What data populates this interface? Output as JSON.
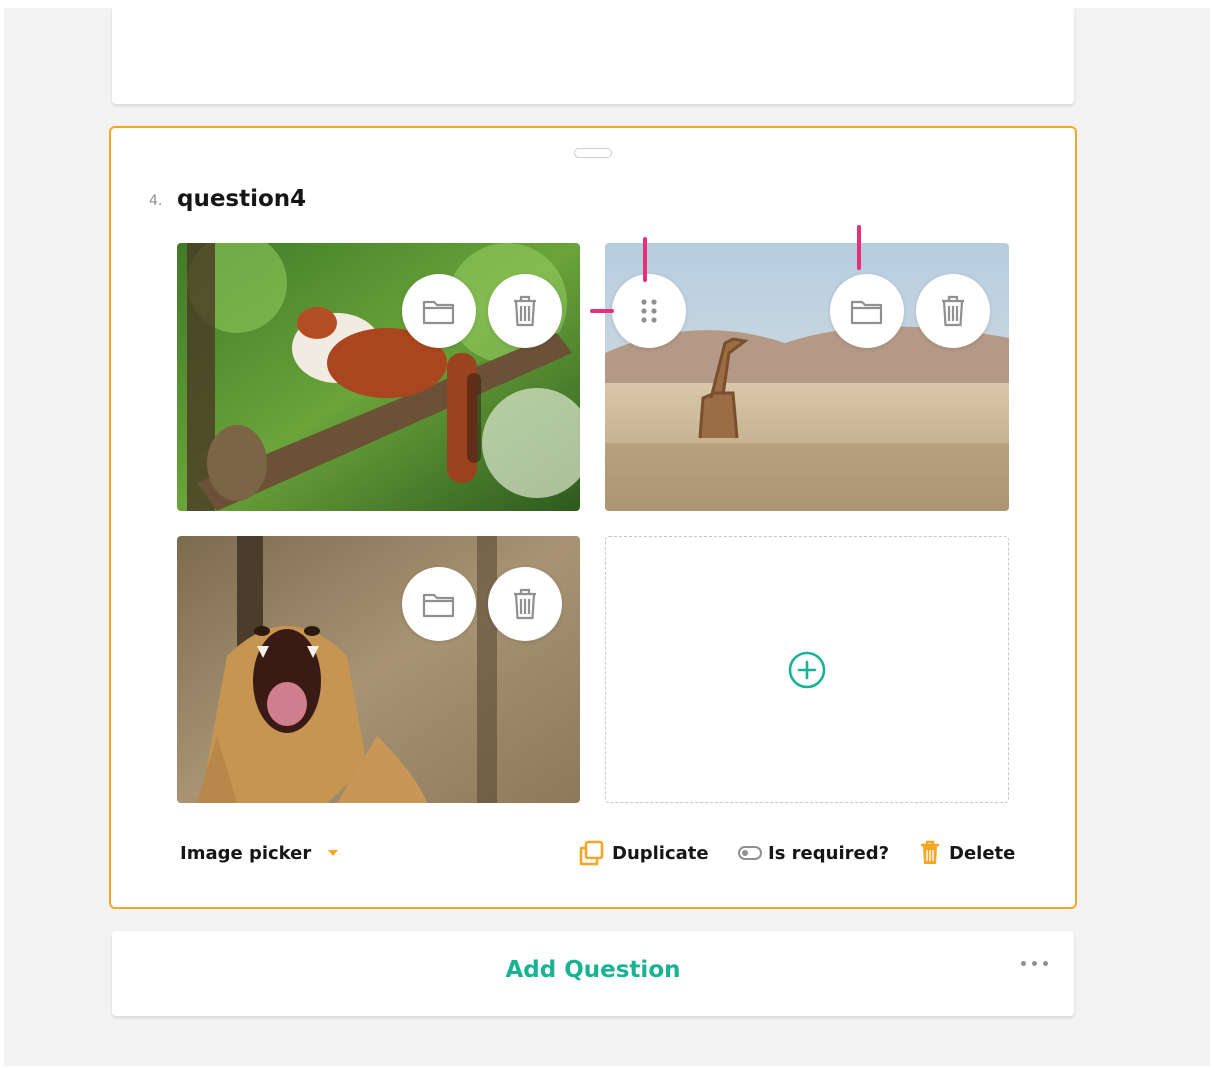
{
  "question": {
    "number": "4.",
    "title": "question4"
  },
  "footer": {
    "type_label": "Image picker",
    "duplicate_label": "Duplicate",
    "required_label": "Is required?",
    "delete_label": "Delete"
  },
  "add_question_label": "Add Question",
  "colors": {
    "accent": "#f6a623",
    "primary": "#19b394",
    "marker": "#e8307a"
  },
  "choices": [
    {
      "subject": "red panda"
    },
    {
      "subject": "giraffe"
    },
    {
      "subject": "lioness"
    }
  ],
  "icons": [
    "folder-icon",
    "trash-icon",
    "drag-handle-icon",
    "add-circle-icon",
    "duplicate-icon",
    "toggle-icon",
    "chevron-down-icon",
    "more-icon"
  ]
}
